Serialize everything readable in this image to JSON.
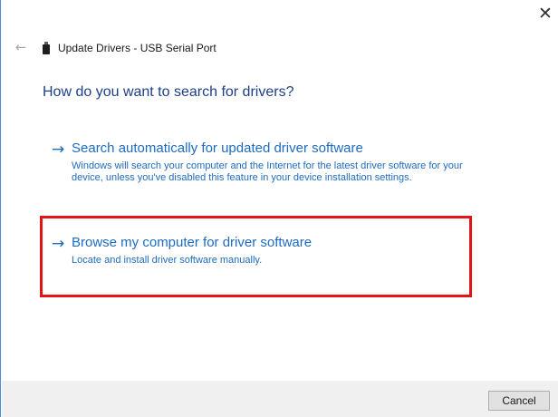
{
  "window": {
    "title": "Update Drivers - USB Serial Port",
    "close_glyph": "✕",
    "back_glyph": "←"
  },
  "main": {
    "heading": "How do you want to search for drivers?",
    "options": [
      {
        "arrow": "→",
        "title": "Search automatically for updated driver software",
        "description": "Windows will search your computer and the Internet for the latest driver software for your device, unless you've disabled this feature in your device installation settings."
      },
      {
        "arrow": "→",
        "title": "Browse my computer for driver software",
        "description": "Locate and install driver software manually."
      }
    ]
  },
  "footer": {
    "cancel_label": "Cancel"
  },
  "icons": {
    "back": "back-arrow-icon",
    "close": "close-icon",
    "device": "usb-device-icon",
    "option_arrow": "arrow-right-icon"
  },
  "colors": {
    "link": "#1f6bbf",
    "heading": "#1e3f8a",
    "highlight": "#e51414",
    "footer_bg": "#f0f0f0"
  }
}
